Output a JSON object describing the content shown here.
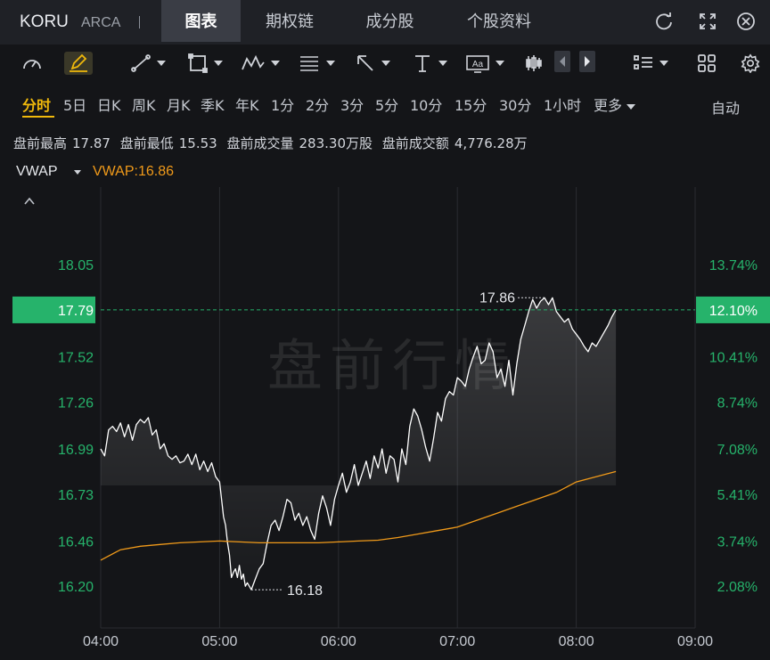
{
  "header": {
    "ticker": "KORU",
    "exchange": "ARCA",
    "tabs": [
      {
        "label": "图表",
        "active": true
      },
      {
        "label": "期权链",
        "active": false
      },
      {
        "label": "成分股",
        "active": false
      },
      {
        "label": "个股资料",
        "active": false
      }
    ],
    "icons": [
      "refresh-icon",
      "expand-icon",
      "close-icon"
    ]
  },
  "toolbar": {
    "icons": [
      "gauge-icon",
      "pencil-icon",
      "line-tool-icon",
      "rectangle-tool-icon",
      "pattern-tool-icon",
      "fibonacci-tool-icon",
      "arrow-tool-icon",
      "vertical-line-tool-icon",
      "text-tool-icon",
      "candlestick-icon",
      "prev-icon",
      "next-icon",
      "list-icon",
      "grid-icon",
      "settings-icon"
    ],
    "text_tool_label": "Aa"
  },
  "periods": {
    "items": [
      "分时",
      "5日",
      "日K",
      "周K",
      "月K",
      "季K",
      "年K",
      "1分",
      "2分",
      "3分",
      "5分",
      "10分",
      "15分",
      "30分",
      "1小时",
      "更多"
    ],
    "active": "分时",
    "right_label": "自动"
  },
  "summary": {
    "high_label": "盘前最高",
    "high": "17.87",
    "low_label": "盘前最低",
    "low": "15.53",
    "vol_label": "盘前成交量",
    "vol": "283.30万股",
    "amt_label": "盘前成交额",
    "amt": "4,776.28万"
  },
  "indicator": {
    "name": "VWAP",
    "value_text": "VWAP:16.86"
  },
  "chart_data": {
    "type": "line",
    "watermark": "盘前行情",
    "x_ticks": [
      "04:00",
      "05:00",
      "06:00",
      "07:00",
      "08:00",
      "09:00"
    ],
    "y_ticks": [
      "18.05",
      "17.79",
      "17.52",
      "17.26",
      "16.99",
      "16.73",
      "16.46",
      "16.20"
    ],
    "y_pct_ticks": [
      "13.74%",
      "12.10%",
      "10.41%",
      "8.74%",
      "7.08%",
      "5.41%",
      "3.74%",
      "2.08%"
    ],
    "ylim": [
      15.96,
      18.42
    ],
    "xlim_minutes": [
      0,
      300
    ],
    "current_price": "17.79",
    "current_pct": "12.10%",
    "max_label": "17.86",
    "min_label": "16.18",
    "colors": {
      "price": "#ffffff",
      "vwap": "#f09a1a",
      "up": "#26b36b",
      "grid": "#2a2c31"
    },
    "series": [
      {
        "name": "Price",
        "minutes": [
          0,
          2,
          4,
          6,
          8,
          10,
          12,
          14,
          16,
          18,
          20,
          22,
          24,
          26,
          28,
          30,
          32,
          34,
          36,
          38,
          40,
          42,
          44,
          46,
          48,
          50,
          52,
          54,
          56,
          58,
          60,
          61,
          62,
          63,
          64,
          65,
          66,
          67,
          68,
          69,
          70,
          71,
          72,
          73,
          74,
          76,
          78,
          80,
          82,
          84,
          86,
          88,
          90,
          92,
          94,
          96,
          98,
          100,
          102,
          104,
          106,
          108,
          110,
          112,
          114,
          116,
          118,
          120,
          122,
          124,
          126,
          128,
          130,
          132,
          134,
          136,
          138,
          140,
          142,
          144,
          146,
          148,
          150,
          152,
          154,
          156,
          158,
          160,
          162,
          164,
          166,
          168,
          170,
          172,
          174,
          176,
          178,
          180,
          182,
          184,
          186,
          188,
          190,
          192,
          194,
          196,
          198,
          200,
          202,
          204,
          206,
          208,
          210,
          212,
          214,
          216,
          218,
          220,
          222,
          224,
          226,
          228,
          230,
          232,
          234,
          236,
          238,
          240,
          242,
          244,
          246,
          248,
          250,
          252,
          254,
          256,
          258,
          260
        ],
        "values": [
          16.99,
          16.95,
          17.1,
          17.12,
          17.09,
          17.14,
          17.06,
          17.13,
          17.04,
          17.13,
          17.16,
          17.14,
          17.17,
          17.07,
          17.1,
          16.99,
          17.02,
          16.95,
          16.93,
          16.95,
          16.91,
          16.92,
          16.96,
          16.9,
          16.96,
          16.87,
          16.92,
          16.86,
          16.91,
          16.83,
          16.8,
          16.7,
          16.6,
          16.55,
          16.45,
          16.38,
          16.25,
          16.28,
          16.3,
          16.25,
          16.32,
          16.24,
          16.27,
          16.2,
          16.22,
          16.18,
          16.24,
          16.3,
          16.33,
          16.45,
          16.55,
          16.58,
          16.52,
          16.6,
          16.7,
          16.68,
          16.58,
          16.62,
          16.55,
          16.6,
          16.52,
          16.47,
          16.62,
          16.72,
          16.65,
          16.55,
          16.7,
          16.78,
          16.85,
          16.74,
          16.8,
          16.9,
          16.78,
          16.85,
          16.92,
          16.82,
          16.95,
          16.88,
          16.99,
          16.85,
          16.95,
          16.93,
          16.8,
          16.99,
          16.9,
          17.12,
          17.22,
          17.18,
          17.1,
          17.0,
          16.92,
          17.05,
          17.2,
          17.15,
          17.28,
          17.32,
          17.3,
          17.4,
          17.38,
          17.35,
          17.45,
          17.52,
          17.58,
          17.48,
          17.5,
          17.6,
          17.55,
          17.4,
          17.45,
          17.35,
          17.5,
          17.3,
          17.48,
          17.62,
          17.7,
          17.78,
          17.85,
          17.8,
          17.84,
          17.86,
          17.82,
          17.86,
          17.78,
          17.75,
          17.72,
          17.74,
          17.68,
          17.65,
          17.62,
          17.58,
          17.55,
          17.6,
          17.58,
          17.62,
          17.66,
          17.7,
          17.75,
          17.79
        ]
      },
      {
        "name": "VWAP",
        "minutes": [
          0,
          10,
          20,
          30,
          40,
          50,
          60,
          70,
          80,
          90,
          100,
          110,
          120,
          130,
          140,
          150,
          160,
          170,
          180,
          190,
          200,
          210,
          220,
          230,
          240,
          250,
          260
        ],
        "values": [
          16.35,
          16.41,
          16.43,
          16.44,
          16.45,
          16.455,
          16.46,
          16.455,
          16.45,
          16.45,
          16.45,
          16.45,
          16.455,
          16.46,
          16.465,
          16.48,
          16.5,
          16.52,
          16.54,
          16.58,
          16.62,
          16.66,
          16.7,
          16.74,
          16.8,
          16.83,
          16.86
        ]
      }
    ]
  }
}
